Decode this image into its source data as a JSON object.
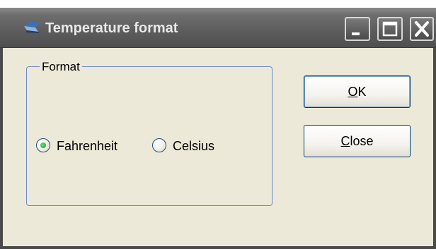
{
  "window": {
    "title": "Temperature format"
  },
  "title_bar": {
    "icons": [
      "app-icon",
      "minimize-icon",
      "maximize-icon",
      "close-icon"
    ]
  },
  "format_group": {
    "legend": "Format",
    "options": [
      {
        "label": "Fahrenheit",
        "selected": true
      },
      {
        "label": "Celsius",
        "selected": false
      }
    ]
  },
  "buttons": {
    "ok": {
      "mnemonic": "O",
      "rest": "K"
    },
    "close": {
      "mnemonic": "C",
      "rest": "lose"
    }
  },
  "colors": {
    "dialog_bg": "#ECE9D8",
    "titlebar": "#5e5e5e",
    "group_border": "#6b8ac8",
    "radio_selected": "#1d9a1d"
  }
}
